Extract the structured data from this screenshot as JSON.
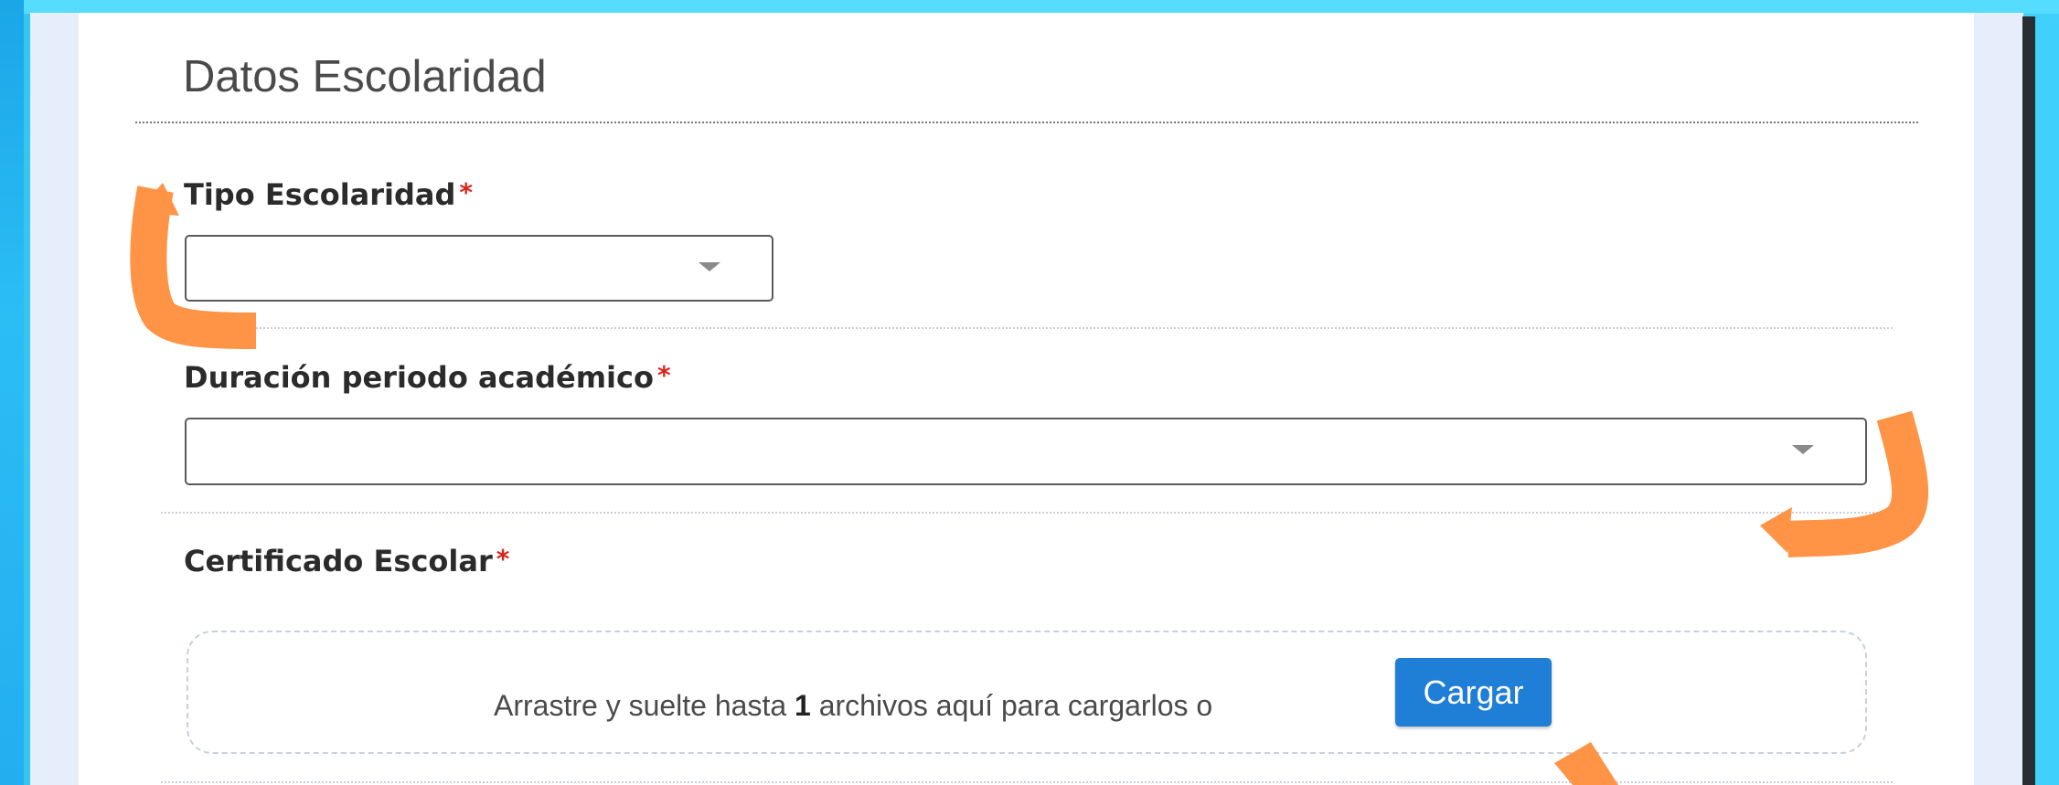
{
  "section": {
    "title": "Datos Escolaridad"
  },
  "fields": {
    "tipo_escolaridad": {
      "label": "Tipo Escolaridad",
      "required_mark": "*",
      "value": ""
    },
    "duracion_periodo": {
      "label": "Duración periodo académico",
      "required_mark": "*",
      "value": ""
    },
    "certificado_escolar": {
      "label": "Certificado Escolar",
      "required_mark": "*",
      "dropzone": {
        "text_before": "Arrastre y suelte hasta ",
        "max_files": "1",
        "text_after": " archivos aquí para cargarlos o",
        "button_label": "Cargar"
      }
    }
  },
  "annotations": {
    "arrow_color": "#ff9346"
  },
  "icons": {
    "select_caret": "chevron-down-icon"
  }
}
